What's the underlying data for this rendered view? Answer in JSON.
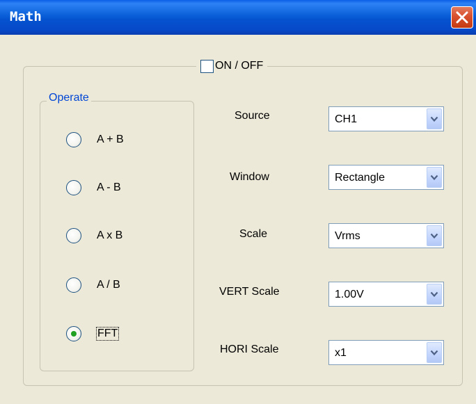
{
  "window": {
    "title": "Math"
  },
  "title_bar": {
    "close_icon": "close-icon"
  },
  "toggle": {
    "label": "ON / OFF",
    "checked": false
  },
  "operate": {
    "legend": "Operate",
    "options": [
      {
        "label": "A + B",
        "selected": false
      },
      {
        "label": "A - B",
        "selected": false
      },
      {
        "label": "A x B",
        "selected": false
      },
      {
        "label": "A / B",
        "selected": false
      },
      {
        "label": "FFT",
        "selected": true
      }
    ]
  },
  "settings": [
    {
      "label": "Source",
      "value": "CH1"
    },
    {
      "label": "Window",
      "value": "Rectangle"
    },
    {
      "label": "Scale",
      "value": "Vrms"
    },
    {
      "label": "VERT Scale",
      "value": "1.00V"
    },
    {
      "label": "HORI Scale",
      "value": "x1"
    }
  ],
  "colors": {
    "title_bar": "#0553d0",
    "group_legend": "#0046d5",
    "radio_dot": "#21a121",
    "close_button": "#d8502d"
  }
}
